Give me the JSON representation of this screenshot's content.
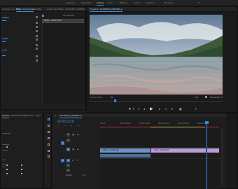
{
  "workspaces": [
    "Learning",
    "Assembly",
    "Editing",
    "Color",
    "Effects",
    "Audio",
    "Graphics",
    "Libraries"
  ],
  "workspace_active": 2,
  "workspace_more": "»",
  "source_tabs": [
    "Source: (no clips)",
    "Effect Controls ≡",
    "Metadata",
    "Audio Clip Mixer: 20190816_OMOM4"
  ],
  "program_tab": "Program: 20190816_OMOM4 ≡",
  "program_timecode": "00;00;23;04",
  "program_fit": "Fit",
  "program_fraction": "1/2",
  "program_duration": "00;02;51;17",
  "mini_clip_label": "Water - Lakebridge",
  "mini_timecode": "00;00;23;04",
  "project_tabs": [
    "Project",
    "Media Browser",
    "Libraries",
    "Info"
  ],
  "timeline_tab": "20190816_OMOM4 ≡",
  "timeline_timecode": "00;00;23;04",
  "ruler_ticks": [
    "00;00",
    "00;00;30;00",
    "00;01;00;00",
    "00;01;30;00",
    "00;02;00;00",
    "00;02;30;00"
  ],
  "tracks": {
    "video": [
      "V3",
      "V2",
      "V1"
    ],
    "audio": [
      "A1",
      "A2",
      "A3"
    ],
    "master": "Master",
    "master_value": "0.0"
  },
  "clips": {
    "v1_a": "Water - Lakebridge",
    "v1_b": "Lake - Deiris.mp4"
  },
  "transport_icons": [
    "mark-in",
    "mark-out",
    "go-to-in",
    "step-back",
    "play",
    "step-forward",
    "go-to-out",
    "lift",
    "extract",
    "export-frame"
  ],
  "colors": {
    "accent": "#2d8ceb",
    "clip_blue": "#6b93c4",
    "clip_purple": "#b99cd8",
    "playhead": "#2d8ceb"
  }
}
